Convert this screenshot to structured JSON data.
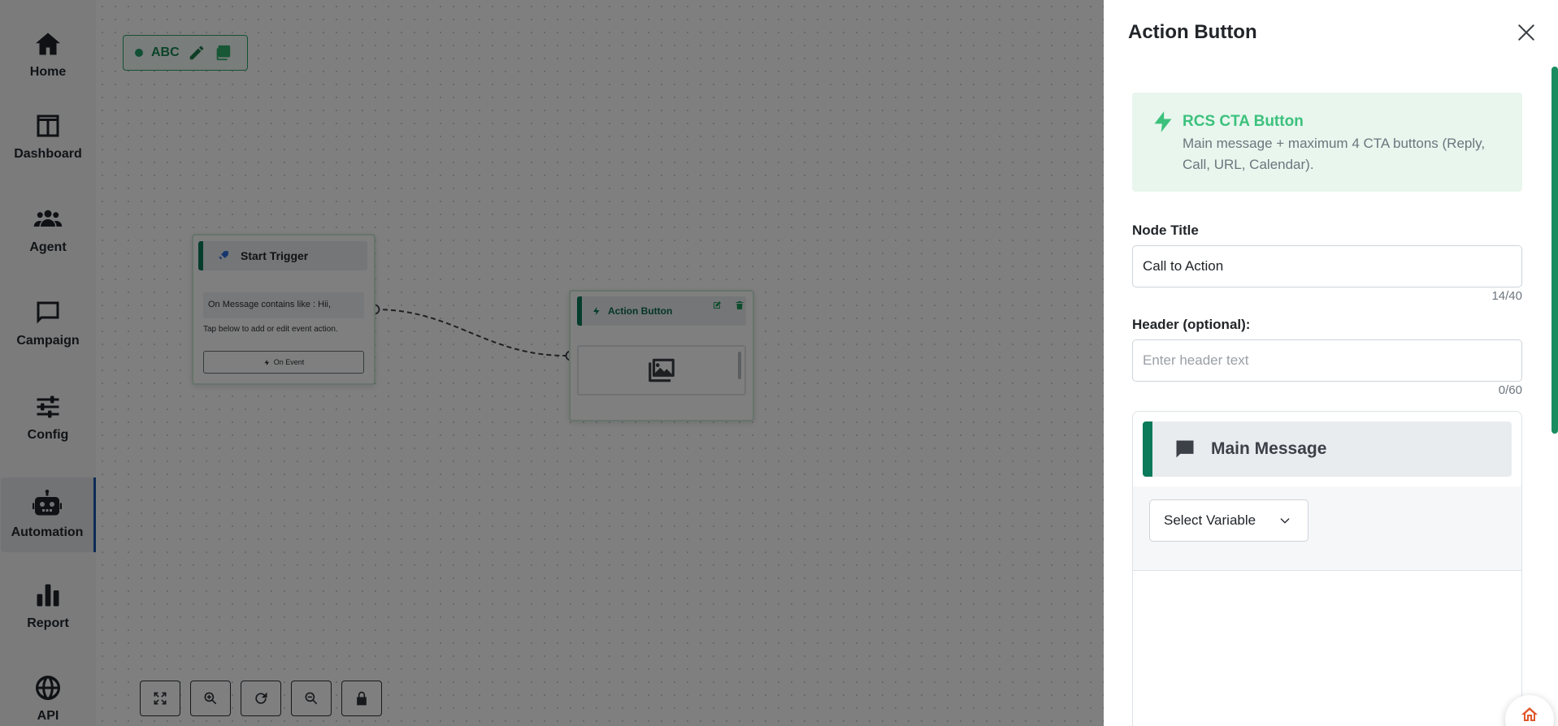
{
  "sidebar": {
    "items": [
      {
        "label": "Home",
        "icon": "home-icon"
      },
      {
        "label": "Dashboard",
        "icon": "dashboard-icon"
      },
      {
        "label": "Agent",
        "icon": "agent-icon"
      },
      {
        "label": "Campaign",
        "icon": "campaign-icon"
      },
      {
        "label": "Config",
        "icon": "config-icon"
      },
      {
        "label": "Automation",
        "icon": "automation-icon",
        "active": true
      },
      {
        "label": "Report",
        "icon": "report-icon"
      },
      {
        "label": "API",
        "icon": "api-icon"
      }
    ]
  },
  "canvas": {
    "flow_name": "ABC",
    "nodes": {
      "start_trigger": {
        "title": "Start Trigger",
        "message": "On Message contains like : Hii,",
        "hint": "Tap below to add or edit event action.",
        "event_button": "On Event"
      },
      "action_button": {
        "title": "Action Button"
      }
    },
    "controls": [
      "fullscreen-icon",
      "zoom-in-icon",
      "reset-icon",
      "zoom-out-icon",
      "lock-icon"
    ]
  },
  "panel": {
    "title": "Action Button",
    "info": {
      "title": "RCS CTA Button",
      "description": "Main message + maximum 4 CTA buttons (Reply, Call, URL, Calendar)."
    },
    "node_title": {
      "label": "Node Title",
      "value": "Call to Action",
      "counter": "14/40"
    },
    "header": {
      "label": "Header (optional):",
      "placeholder": "Enter header text",
      "counter": "0/60"
    },
    "main_message": {
      "title": "Main Message",
      "select_variable": "Select Variable"
    }
  },
  "colors": {
    "accent": "#0b7a5a",
    "info_title": "#3cc17c",
    "active_indicator": "#1a57a8"
  }
}
